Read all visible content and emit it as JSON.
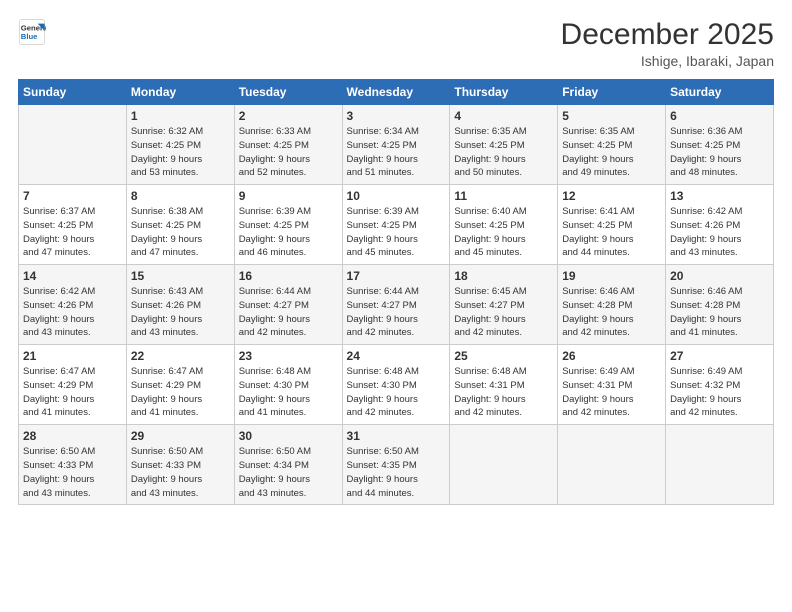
{
  "header": {
    "logo_line1": "General",
    "logo_line2": "Blue",
    "title": "December 2025",
    "subtitle": "Ishige, Ibaraki, Japan"
  },
  "days_of_week": [
    "Sunday",
    "Monday",
    "Tuesday",
    "Wednesday",
    "Thursday",
    "Friday",
    "Saturday"
  ],
  "weeks": [
    [
      {
        "day": "",
        "info": ""
      },
      {
        "day": "1",
        "info": "Sunrise: 6:32 AM\nSunset: 4:25 PM\nDaylight: 9 hours\nand 53 minutes."
      },
      {
        "day": "2",
        "info": "Sunrise: 6:33 AM\nSunset: 4:25 PM\nDaylight: 9 hours\nand 52 minutes."
      },
      {
        "day": "3",
        "info": "Sunrise: 6:34 AM\nSunset: 4:25 PM\nDaylight: 9 hours\nand 51 minutes."
      },
      {
        "day": "4",
        "info": "Sunrise: 6:35 AM\nSunset: 4:25 PM\nDaylight: 9 hours\nand 50 minutes."
      },
      {
        "day": "5",
        "info": "Sunrise: 6:35 AM\nSunset: 4:25 PM\nDaylight: 9 hours\nand 49 minutes."
      },
      {
        "day": "6",
        "info": "Sunrise: 6:36 AM\nSunset: 4:25 PM\nDaylight: 9 hours\nand 48 minutes."
      }
    ],
    [
      {
        "day": "7",
        "info": "Sunrise: 6:37 AM\nSunset: 4:25 PM\nDaylight: 9 hours\nand 47 minutes."
      },
      {
        "day": "8",
        "info": "Sunrise: 6:38 AM\nSunset: 4:25 PM\nDaylight: 9 hours\nand 47 minutes."
      },
      {
        "day": "9",
        "info": "Sunrise: 6:39 AM\nSunset: 4:25 PM\nDaylight: 9 hours\nand 46 minutes."
      },
      {
        "day": "10",
        "info": "Sunrise: 6:39 AM\nSunset: 4:25 PM\nDaylight: 9 hours\nand 45 minutes."
      },
      {
        "day": "11",
        "info": "Sunrise: 6:40 AM\nSunset: 4:25 PM\nDaylight: 9 hours\nand 45 minutes."
      },
      {
        "day": "12",
        "info": "Sunrise: 6:41 AM\nSunset: 4:25 PM\nDaylight: 9 hours\nand 44 minutes."
      },
      {
        "day": "13",
        "info": "Sunrise: 6:42 AM\nSunset: 4:26 PM\nDaylight: 9 hours\nand 43 minutes."
      }
    ],
    [
      {
        "day": "14",
        "info": "Sunrise: 6:42 AM\nSunset: 4:26 PM\nDaylight: 9 hours\nand 43 minutes."
      },
      {
        "day": "15",
        "info": "Sunrise: 6:43 AM\nSunset: 4:26 PM\nDaylight: 9 hours\nand 43 minutes."
      },
      {
        "day": "16",
        "info": "Sunrise: 6:44 AM\nSunset: 4:27 PM\nDaylight: 9 hours\nand 42 minutes."
      },
      {
        "day": "17",
        "info": "Sunrise: 6:44 AM\nSunset: 4:27 PM\nDaylight: 9 hours\nand 42 minutes."
      },
      {
        "day": "18",
        "info": "Sunrise: 6:45 AM\nSunset: 4:27 PM\nDaylight: 9 hours\nand 42 minutes."
      },
      {
        "day": "19",
        "info": "Sunrise: 6:46 AM\nSunset: 4:28 PM\nDaylight: 9 hours\nand 42 minutes."
      },
      {
        "day": "20",
        "info": "Sunrise: 6:46 AM\nSunset: 4:28 PM\nDaylight: 9 hours\nand 41 minutes."
      }
    ],
    [
      {
        "day": "21",
        "info": "Sunrise: 6:47 AM\nSunset: 4:29 PM\nDaylight: 9 hours\nand 41 minutes."
      },
      {
        "day": "22",
        "info": "Sunrise: 6:47 AM\nSunset: 4:29 PM\nDaylight: 9 hours\nand 41 minutes."
      },
      {
        "day": "23",
        "info": "Sunrise: 6:48 AM\nSunset: 4:30 PM\nDaylight: 9 hours\nand 41 minutes."
      },
      {
        "day": "24",
        "info": "Sunrise: 6:48 AM\nSunset: 4:30 PM\nDaylight: 9 hours\nand 42 minutes."
      },
      {
        "day": "25",
        "info": "Sunrise: 6:48 AM\nSunset: 4:31 PM\nDaylight: 9 hours\nand 42 minutes."
      },
      {
        "day": "26",
        "info": "Sunrise: 6:49 AM\nSunset: 4:31 PM\nDaylight: 9 hours\nand 42 minutes."
      },
      {
        "day": "27",
        "info": "Sunrise: 6:49 AM\nSunset: 4:32 PM\nDaylight: 9 hours\nand 42 minutes."
      }
    ],
    [
      {
        "day": "28",
        "info": "Sunrise: 6:50 AM\nSunset: 4:33 PM\nDaylight: 9 hours\nand 43 minutes."
      },
      {
        "day": "29",
        "info": "Sunrise: 6:50 AM\nSunset: 4:33 PM\nDaylight: 9 hours\nand 43 minutes."
      },
      {
        "day": "30",
        "info": "Sunrise: 6:50 AM\nSunset: 4:34 PM\nDaylight: 9 hours\nand 43 minutes."
      },
      {
        "day": "31",
        "info": "Sunrise: 6:50 AM\nSunset: 4:35 PM\nDaylight: 9 hours\nand 44 minutes."
      },
      {
        "day": "",
        "info": ""
      },
      {
        "day": "",
        "info": ""
      },
      {
        "day": "",
        "info": ""
      }
    ]
  ]
}
